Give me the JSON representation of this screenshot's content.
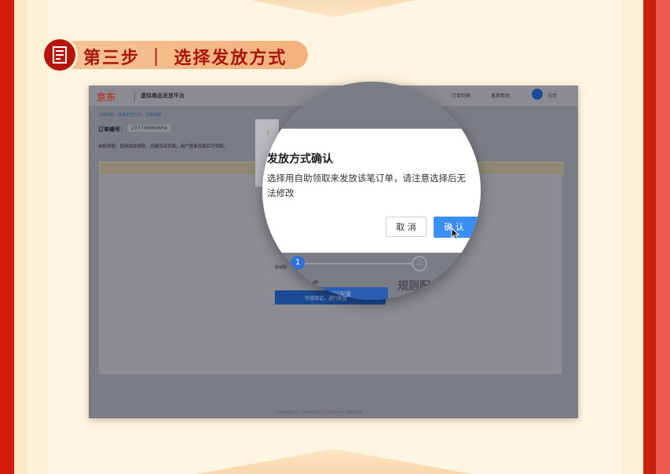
{
  "step": {
    "title": "第三步 ｜ 选择发放方式",
    "icon": "document-list-icon"
  },
  "app": {
    "logo": "京东",
    "platform": "虚拟商品发放平台",
    "header_links": [
      "订单列表",
      "发放帮助"
    ],
    "user": "古月"
  },
  "breadcrumb": "订单列表 › 选择发放方式 › 自助领取",
  "order": {
    "label": "订单编号：",
    "number": "237738964659"
  },
  "notice": "自助领取：使用自助领取，创建活动页面，用户登录页面后可领取。",
  "steps": {
    "small_label": "验证码",
    "step1": "1",
    "step2": "2",
    "step1_label": "式",
    "step2_label": "规则配"
  },
  "main_button": "完成验证，进行配置",
  "copyright": "Copyright © 2004-2020 京东JD.com 版权所有",
  "dialog": {
    "title": "发放方式确认",
    "message": "选择用自助领取来发放该笔订单，请注意选择后无法修改",
    "cancel": "取 消",
    "confirm": "确 认"
  },
  "colors": {
    "primary": "#3a8ef6",
    "accent_red": "#b7150b"
  }
}
